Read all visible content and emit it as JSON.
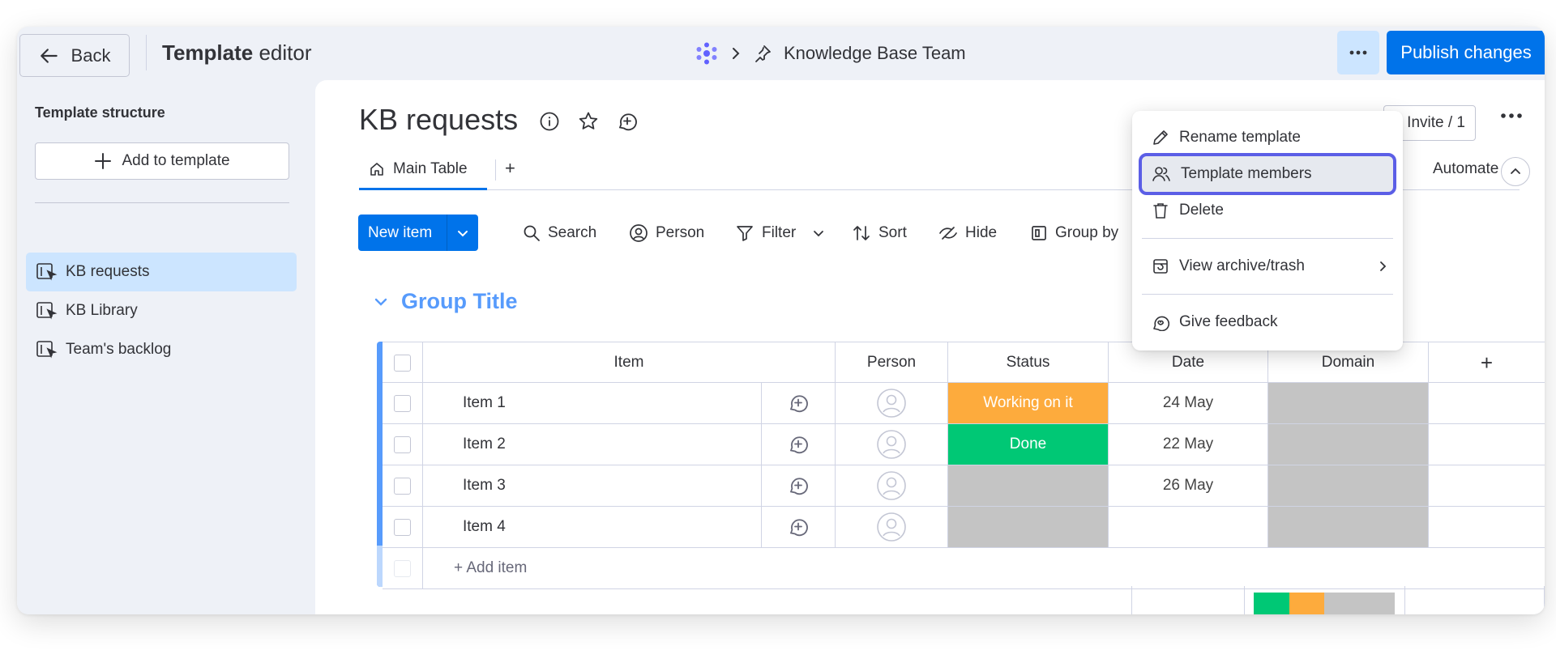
{
  "topbar": {
    "back_label": "Back",
    "title_bold": "Template",
    "title_rest": " editor",
    "breadcrumb_workspace": "Knowledge Base Team",
    "publish_label": "Publish changes"
  },
  "sidebar": {
    "title": "Template structure",
    "add_label": "Add to template",
    "items": [
      {
        "label": "KB requests",
        "active": true
      },
      {
        "label": "KB Library",
        "active": false
      },
      {
        "label": "Team's backlog",
        "active": false
      }
    ]
  },
  "board": {
    "title": "KB requests",
    "invite_label": "Invite / 1",
    "tabs": [
      {
        "label": "Main Table"
      }
    ],
    "tab_add": "+",
    "automate_label": "Automate",
    "toolbar": {
      "new_item": "New item",
      "search": "Search",
      "person": "Person",
      "filter": "Filter",
      "sort": "Sort",
      "hide": "Hide",
      "group_by": "Group by"
    },
    "group": {
      "title": "Group Title",
      "columns": [
        "Item",
        "Person",
        "Status",
        "Date",
        "Domain"
      ],
      "add_column": "+",
      "rows": [
        {
          "item": "Item 1",
          "status": "Working on it",
          "date": "24 May"
        },
        {
          "item": "Item 2",
          "status": "Done",
          "date": "22 May"
        },
        {
          "item": "Item 3",
          "status": "",
          "date": "26 May"
        },
        {
          "item": "Item 4",
          "status": "",
          "date": ""
        }
      ],
      "add_item": "+ Add item"
    }
  },
  "menu": {
    "items": [
      {
        "label": "Rename template",
        "icon": "pencil-icon"
      },
      {
        "label": "Template members",
        "icon": "people-icon",
        "highlighted": true
      },
      {
        "label": "Delete",
        "icon": "trash-icon"
      },
      {
        "label": "View archive/trash",
        "icon": "archive-icon"
      },
      {
        "label": "Give feedback",
        "icon": "feedback-icon"
      }
    ]
  },
  "colors": {
    "primary": "#0073ea",
    "group_blue": "#579bfc",
    "working": "#fdab3d",
    "done": "#00c875",
    "empty": "#c4c4c4",
    "highlight_outline": "#5b5ee6"
  }
}
